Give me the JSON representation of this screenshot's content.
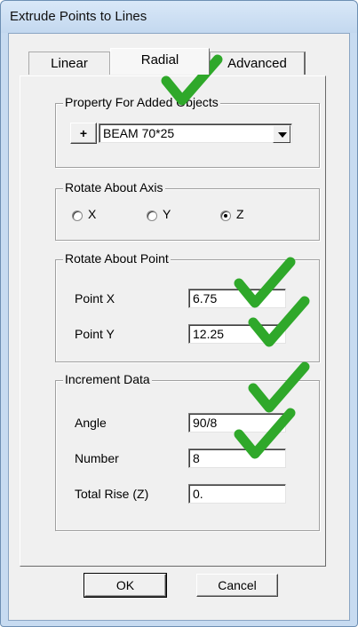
{
  "window": {
    "title": "Extrude Points to Lines"
  },
  "tabs": [
    {
      "label": "Linear"
    },
    {
      "label": "Radial"
    },
    {
      "label": "Advanced"
    }
  ],
  "property": {
    "legend": "Property For Added Objects",
    "plus_label": "+",
    "selected": "BEAM 70*25"
  },
  "axis": {
    "legend": "Rotate About Axis",
    "options": [
      {
        "label": "X",
        "selected": false
      },
      {
        "label": "Y",
        "selected": false
      },
      {
        "label": "Z",
        "selected": true
      }
    ]
  },
  "point": {
    "legend": "Rotate About Point",
    "x_label": "Point X",
    "x_value": "6.75",
    "y_label": "Point Y",
    "y_value": "12.25"
  },
  "increment": {
    "legend": "Increment Data",
    "angle_label": "Angle",
    "angle_value": "90/8",
    "number_label": "Number",
    "number_value": "8",
    "rise_label": "Total Rise (Z)",
    "rise_value": "0."
  },
  "buttons": {
    "ok": "OK",
    "cancel": "Cancel"
  },
  "annotation_color": "#2fa82a"
}
